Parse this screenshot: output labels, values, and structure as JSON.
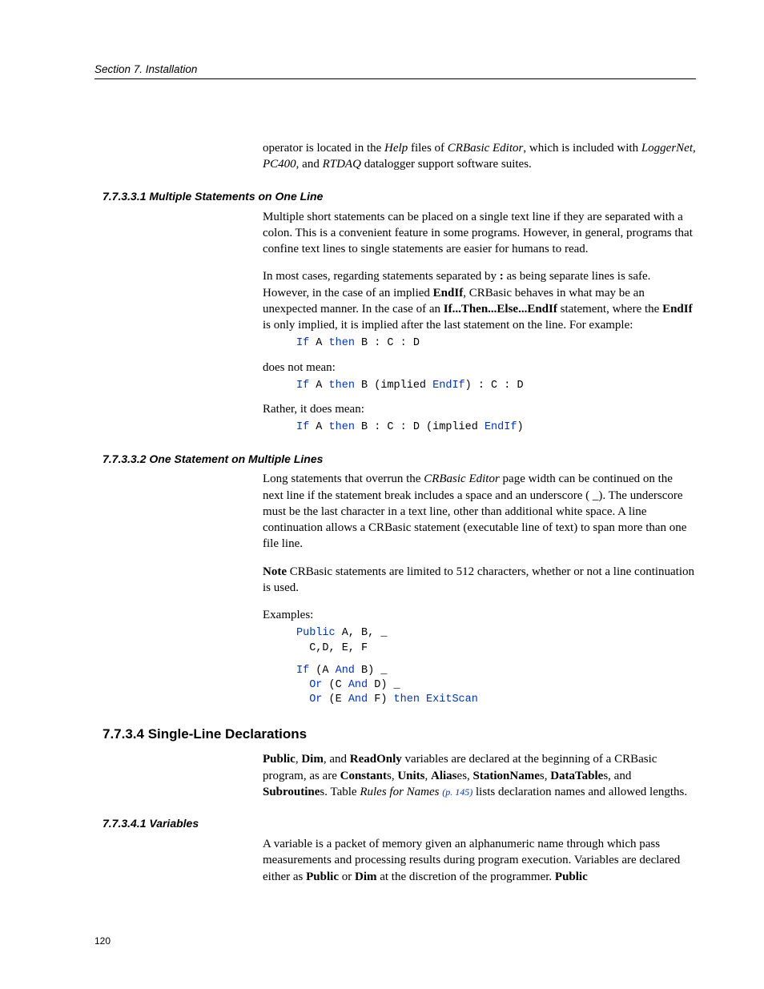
{
  "runningHead": "Section 7.  Installation",
  "intro": {
    "t1": "operator is located in the ",
    "t2": "Help",
    "t3": " files of ",
    "t4": "CRBasic Editor",
    "t5": ", which is included with ",
    "t6": "LoggerNet",
    "t7": ", ",
    "t8": "PC400",
    "t9": ", and ",
    "t10": "RTDAQ",
    "t11": " datalogger support software suites."
  },
  "s1": {
    "heading": "7.7.3.3.1 Multiple Statements on One Line",
    "p1": "Multiple short statements can be placed on a single text line if they are separated with a colon.  This is a convenient feature in some programs.  However, in general, programs that confine text lines to single statements are easier for humans to read.",
    "p2a": "In most cases, regarding statements separated by ",
    "p2b": ":",
    "p2c": " as being separate lines is safe. However, in the case of an implied ",
    "p2d": "EndIf",
    "p2e": ", CRBasic behaves in what may be an unexpected manner.  In the case of an ",
    "p2f": "If...Then...Else...EndIf",
    "p2g": " statement, where the ",
    "p2h": "EndIf",
    "p2i": " is only implied, it is implied after the last statement on the line.  For example:",
    "code1": {
      "k1": "If",
      "t1": " A ",
      "k2": "then",
      "t2": " B : C : D"
    },
    "p3": "does not mean:",
    "code2": {
      "k1": "If",
      "t1": " A ",
      "k2": "then",
      "t2": " B (implied ",
      "k3": "EndIf",
      "t3": ") : C : D"
    },
    "p4": "Rather, it does mean:",
    "code3": {
      "k1": "If",
      "t1": " A ",
      "k2": "then",
      "t2": " B : C : D (implied ",
      "k3": "EndIf",
      "t3": ")"
    }
  },
  "s2": {
    "heading": "7.7.3.3.2 One Statement on Multiple Lines",
    "p1a": "Long statements that overrun the ",
    "p1b": "CRBasic Editor",
    "p1c": " page width can be continued on the next line if the statement break includes a space and an underscore ( _).  The underscore must be the last character in a text line, other than additional white space.  A line continuation allows a CRBasic statement (executable line of text) to span more than one file line.",
    "note_a": "Note",
    "note_b": "  CRBasic statements are limited to 512 characters, whether or not a line continuation is used.",
    "p2": "Examples:",
    "code1": {
      "k1": "Public",
      "t1": " A, B, _\n  C,D, E, F"
    },
    "code2": {
      "k1": "If",
      "t1": " (A ",
      "k2": "And",
      "t2": " B) _\n  ",
      "k3": "Or",
      "t3": " (C ",
      "k4": "And",
      "t4": " D) _\n  ",
      "k5": "Or",
      "t5": " (E ",
      "k6": "And",
      "t6": " F) ",
      "k7": "then",
      "t7": " ",
      "k8": "ExitScan"
    }
  },
  "s3": {
    "heading": "7.7.3.4 Single-Line Declarations",
    "p1a": "Public",
    "p1b": ", ",
    "p1c": "Dim",
    "p1d": ", and ",
    "p1e": "ReadOnly",
    "p1f": " variables are declared at the beginning of a CRBasic program, as are ",
    "p1g": "Constant",
    "p1h": "s, ",
    "p1i": "Units",
    "p1j": ", ",
    "p1k": "Alias",
    "p1l": "es, ",
    "p1m": "StationName",
    "p1n": "s, ",
    "p1o": "DataTable",
    "p1p": "s, and ",
    "p1q": "Subroutine",
    "p1r": "s.  Table ",
    "p1s": "Rules for Names ",
    "p1t": "(p. 145)",
    "p1u": " lists declaration names and allowed lengths."
  },
  "s4": {
    "heading": "7.7.3.4.1 Variables",
    "p1a": "A variable is a packet of memory given an alphanumeric name through which pass measurements and processing results during program execution. Variables are declared either as ",
    "p1b": "Public",
    "p1c": " or ",
    "p1d": "Dim",
    "p1e": " at the discretion of the programmer. ",
    "p1f": "Public"
  },
  "pageNumber": "120"
}
